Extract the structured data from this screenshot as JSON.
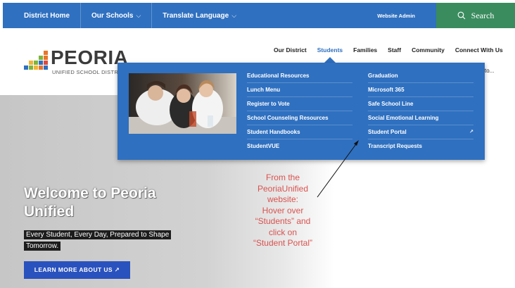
{
  "topbar": {
    "district_home": "District Home",
    "our_schools": "Our Schools",
    "translate": "Translate Language",
    "chevron": "⌵",
    "website_admin": "Website Admin",
    "search": "Search"
  },
  "logo": {
    "word": "PEORIA",
    "sub": "UNIFIED SCHOOL DISTRICT"
  },
  "nav": {
    "items": [
      "Our District",
      "Students",
      "Families",
      "Staff",
      "Community",
      "Connect With Us"
    ],
    "active": "Students",
    "trailing_text": "to..."
  },
  "dropdown": {
    "column1": [
      "Educational Resources",
      "Lunch Menu",
      "Register to Vote",
      "School Counseling Resources",
      "Student Handbooks",
      "StudentVUE"
    ],
    "column2": [
      "Graduation",
      "Microsoft 365",
      "Safe School Line",
      "Social Emotional Learning",
      "Student Portal",
      "Transcript Requests"
    ],
    "external_marker": "↗"
  },
  "hero": {
    "title": "Welcome to Peoria Unified",
    "tagline": "Every Student, Every Day, Prepared to Shape Tomorrow.",
    "button": "LEARN MORE ABOUT US ↗"
  },
  "annotation": {
    "lines": [
      "From the",
      "PeoriaUnified",
      "website:",
      "Hover over",
      "“Students” and",
      "click on",
      "“Student Portal”"
    ]
  },
  "colors": {
    "brand_blue": "#2f70c0",
    "search_green": "#3a8c5e",
    "button_blue": "#2a52be",
    "annotation_red": "#d9534f"
  }
}
